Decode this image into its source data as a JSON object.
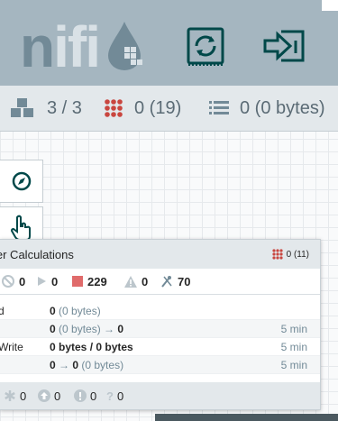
{
  "header": {
    "logo_n": "n",
    "logo_i": "ifi",
    "template_button": "template-icon",
    "login_button": "login-icon"
  },
  "stats": {
    "components_icon": "cubes-icon",
    "components": "3 / 3",
    "queued_icon": "grid-icon",
    "queued": "0 (19)",
    "list_icon": "list-icon",
    "bytes": "0 (0 bytes)"
  },
  "tools": {
    "navigate_icon": "compass-icon",
    "operate_icon": "pointer-icon"
  },
  "process_group": {
    "title": "ler Calculations",
    "queued": "0 (11)",
    "counts": {
      "disabled": "0",
      "running": "0",
      "stopped": "229",
      "invalid": "0",
      "disabled_proc": "70"
    },
    "rows": [
      {
        "label": "d",
        "value_b": "0",
        "value_rest": " (0 bytes)",
        "time": ""
      },
      {
        "label": "",
        "value_b": "0",
        "value_rest": " (0 bytes) → ",
        "value_b2": "0",
        "time": "5 min"
      },
      {
        "label": "Write",
        "value_b": "0 bytes / 0 bytes",
        "value_rest": "",
        "time": "5 min"
      },
      {
        "label": "",
        "value_b": "0",
        "value_rest": " → ",
        "value_b2": "0",
        "value_rest2": " (0 bytes)",
        "time": "5 min"
      }
    ],
    "footer": {
      "up_to_date": "0",
      "locally_modified": "0",
      "stale": "0",
      "sync_failure": "0"
    }
  },
  "colors": {
    "header_bg": "#a5b6c0",
    "logo_dark": "#728a97",
    "logo_light": "#d9e1e6",
    "stopped": "#e06b6b",
    "queued": "#c9463f"
  }
}
